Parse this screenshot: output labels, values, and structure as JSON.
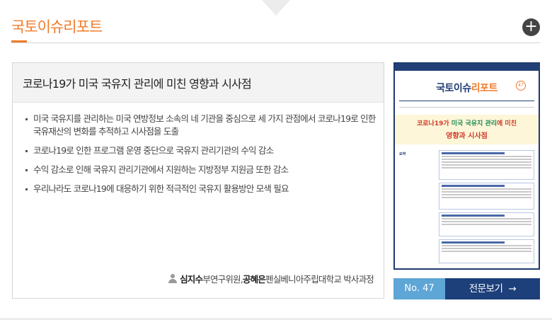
{
  "section": {
    "title": "국토이슈리포트",
    "more_icon": "plus-icon",
    "more_label": "+"
  },
  "report": {
    "title": "코로나19가 미국 국유지 관리에 미친 영향과 시사점",
    "bullets": [
      "미국 국유지를 관리하는 미국 연방정보 소속의 네 기관을 중심으로 세 가지 관점에서 코로나19로 인한 국유재산의 변화를 추적하고 시사점을 도출",
      "코로나19로 인한 프로그램 운영 중단으로 국유지 관리기관의 수익 감소",
      "수익 감소로 인해 국유지 관리기관에서 지원하는 지방정부 지원금 또한 감소",
      "우리나라도 코로나19에 대응하기 위한 적극적인 국유지 활용방안 모색 필요"
    ],
    "author_icon": "person-icon",
    "author1_name": "심지수",
    "author1_role": " 부연구위원, ",
    "author2_name": "공혜은",
    "author2_role": " 펜실베니아주립대학교 박사과정"
  },
  "cover": {
    "logo_main": "국토이슈",
    "logo_accent": "리포트",
    "issue_mark": "47",
    "headline_part1": "코로나19가 ",
    "headline_part2": "미국 국유지 관리",
    "headline_part3": "에 미친",
    "headline_line2": "영향과 시사점",
    "side_label": "요약"
  },
  "footer": {
    "issue_label": "No. 47",
    "full_view_label": "전문보기",
    "arrow": "→"
  }
}
